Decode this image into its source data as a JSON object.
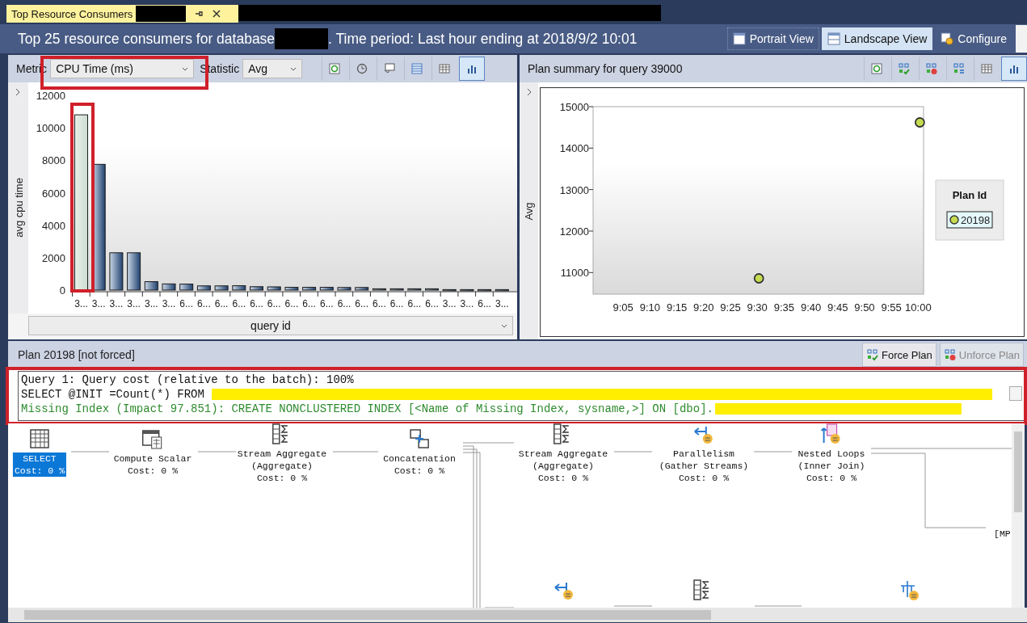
{
  "document_tab": {
    "title": "Top Resource Consumers",
    "selected": true,
    "suffix_redacted": true
  },
  "other_tabs_redacted": true,
  "header": {
    "title_start": "Top 25 resource consumers for database",
    "database_redacted": true,
    "title_end": ". Time period: Last hour ending at 2018/9/2 10:01"
  },
  "view_buttons": [
    {
      "label": "Portrait View",
      "kind": "portrait",
      "selected": false
    },
    {
      "label": "Landscape View",
      "kind": "landscape",
      "selected": true
    },
    {
      "label": "Configure",
      "kind": "configure",
      "selected": false
    }
  ],
  "left_pane": {
    "metric_label": "Metric",
    "metric_value": "CPU Time (ms)",
    "metric_annotated": true,
    "statistic_label": "Statistic",
    "statistic_value": "Avg",
    "tools": [
      {
        "kind": "refresh",
        "selected": false
      },
      {
        "kind": "track",
        "selected": false
      },
      {
        "kind": "comment",
        "selected": false
      },
      {
        "kind": "grid",
        "selected": false
      },
      {
        "kind": "table",
        "selected": false
      },
      {
        "kind": "chart",
        "selected": true
      }
    ],
    "bar_selected": [
      true,
      false,
      false,
      false,
      false,
      false,
      false,
      false,
      false,
      false,
      false,
      false,
      false,
      false,
      false,
      false,
      false,
      false,
      false,
      false,
      false,
      false,
      false,
      false,
      false
    ],
    "chart_data": {
      "type": "bar",
      "xlabel": "query id",
      "ylabel": "avg cpu time",
      "categories": [
        "3...",
        "3...",
        "3...",
        "3...",
        "3...",
        "3...",
        "6...",
        "6...",
        "6...",
        "6...",
        "6...",
        "6...",
        "6...",
        "6...",
        "6...",
        "6...",
        "6...",
        "6...",
        "6...",
        "6...",
        "6...",
        "3...",
        "3...",
        "6...",
        "3..."
      ],
      "values": [
        10800,
        7750,
        2300,
        2300,
        520,
        380,
        370,
        260,
        260,
        270,
        210,
        200,
        170,
        170,
        170,
        160,
        160,
        80,
        80,
        80,
        80,
        30,
        30,
        30,
        30
      ],
      "ylim": [
        0,
        12000
      ],
      "yticks": [
        0,
        2000,
        4000,
        6000,
        8000,
        10000,
        12000
      ]
    },
    "selected_bar_annotated": true
  },
  "right_pane": {
    "title": "Plan summary for query 39000",
    "tools": [
      {
        "kind": "refresh",
        "selected": false
      },
      {
        "kind": "force",
        "selected": false
      },
      {
        "kind": "unforce",
        "selected": false
      },
      {
        "kind": "compare",
        "selected": false
      },
      {
        "kind": "table",
        "selected": false
      },
      {
        "kind": "chart",
        "selected": true
      }
    ],
    "legend_title": "Plan Id",
    "legend_selected": true,
    "chart_data": {
      "type": "scatter",
      "ylabel": "Avg",
      "categories": [
        "9:05",
        "9:10",
        "9:15",
        "9:20",
        "9:25",
        "9:30",
        "9:35",
        "9:40",
        "9:45",
        "9:50",
        "9:55",
        "10:00"
      ],
      "series": [
        {
          "name": "20198",
          "color": "#c5dc50",
          "values": [
            null,
            null,
            null,
            null,
            null,
            10860,
            null,
            null,
            null,
            null,
            null,
            14620
          ]
        }
      ],
      "ylim": [
        10480,
        15000
      ],
      "yticks": [
        11000,
        12000,
        13000,
        14000,
        15000
      ]
    }
  },
  "plan_pane": {
    "title": "Plan 20198 [not forced]",
    "actions": [
      {
        "label": "Force Plan",
        "kind": "force",
        "disabled": false
      },
      {
        "label": "Unforce Plan",
        "kind": "unforce",
        "disabled": true
      }
    ],
    "query_annotated": true,
    "query_lines": [
      {
        "kind": "statement",
        "text": "Query 1: Query cost (relative to the batch): 100%",
        "redacted": false
      },
      {
        "kind": "statement",
        "text": "SELECT @INIT =Count(*) FROM",
        "redacted": true
      },
      {
        "kind": "hint",
        "text": "Missing Index (Impact 97.851): CREATE NONCLUSTERED INDEX [<Name of Missing Index, sysname,>] ON [dbo].",
        "redacted": true
      }
    ],
    "nodes": [
      {
        "kind": "select",
        "lines": [
          "SELECT",
          "Cost: 0 %"
        ],
        "selected": true
      },
      {
        "kind": "compute",
        "lines": [
          "Compute Scalar",
          "Cost: 0 %"
        ],
        "selected": false
      },
      {
        "kind": "aggregate",
        "lines": [
          "Stream Aggregate",
          "(Aggregate)",
          "Cost: 0 %"
        ],
        "selected": false
      },
      {
        "kind": "concat",
        "lines": [
          "Concatenation",
          "Cost: 0 %"
        ],
        "selected": false
      },
      {
        "kind": "aggregate",
        "lines": [
          "Stream Aggregate",
          "(Aggregate)",
          "Cost: 0 %"
        ],
        "selected": false
      },
      {
        "kind": "parallelism",
        "lines": [
          "Parallelism",
          "(Gather Streams)",
          "Cost: 0 %"
        ],
        "selected": false
      },
      {
        "kind": "loops",
        "lines": [
          "Nested Loops",
          "(Inner Join)",
          "Cost: 0 %"
        ],
        "selected": false
      }
    ],
    "lower_nodes": [
      {
        "kind": "parallelism"
      },
      {
        "kind": "aggregate"
      },
      {
        "kind": "scan"
      }
    ],
    "edge_label": "[MP"
  }
}
